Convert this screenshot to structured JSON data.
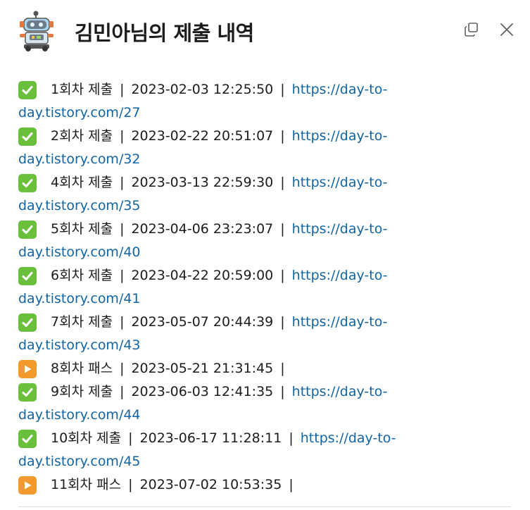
{
  "header": {
    "title": "김민아님의 제출 내역",
    "avatar_icon": "robot-icon",
    "copy_icon": "copy-icon",
    "close_icon": "close-icon"
  },
  "colors": {
    "link": "#1264a3",
    "check_bg": "#6abf3b",
    "pass_bg": "#f29a2e"
  },
  "entries": [
    {
      "status": "check",
      "label": "1회차 제출",
      "timestamp": "2023-02-03 12:25:50",
      "link_part1": "https://day-to-",
      "link_part2": "day.tistory.com/27"
    },
    {
      "status": "check",
      "label": "2회차 제출",
      "timestamp": "2023-02-22 20:51:07",
      "link_part1": "https://day-to-",
      "link_part2": "day.tistory.com/32"
    },
    {
      "status": "check",
      "label": "4회차 제출",
      "timestamp": "2023-03-13 22:59:30",
      "link_part1": "https://day-to-",
      "link_part2": "day.tistory.com/35"
    },
    {
      "status": "check",
      "label": "5회차 제출",
      "timestamp": "2023-04-06 23:23:07",
      "link_part1": "https://day-to-",
      "link_part2": "day.tistory.com/40"
    },
    {
      "status": "check",
      "label": "6회차 제출",
      "timestamp": "2023-04-22 20:59:00",
      "link_part1": "https://day-to-",
      "link_part2": "day.tistory.com/41"
    },
    {
      "status": "check",
      "label": "7회차 제출",
      "timestamp": "2023-05-07 20:44:39",
      "link_part1": "https://day-to-",
      "link_part2": "day.tistory.com/43"
    },
    {
      "status": "pass",
      "label": "8회차 패스",
      "timestamp": "2023-05-21 21:31:45",
      "link_part1": "",
      "link_part2": ""
    },
    {
      "status": "check",
      "label": "9회차 제출",
      "timestamp": "2023-06-03 12:41:35",
      "link_part1": "https://day-to-",
      "link_part2": "day.tistory.com/44"
    },
    {
      "status": "check",
      "label": "10회차 제출",
      "timestamp": "2023-06-17 11:28:11",
      "link_part1": "https://day-to-",
      "link_part2": "day.tistory.com/45"
    },
    {
      "status": "pass",
      "label": "11회차 패스",
      "timestamp": "2023-07-02 10:53:35",
      "link_part1": "",
      "link_part2": ""
    }
  ],
  "separator": "|"
}
